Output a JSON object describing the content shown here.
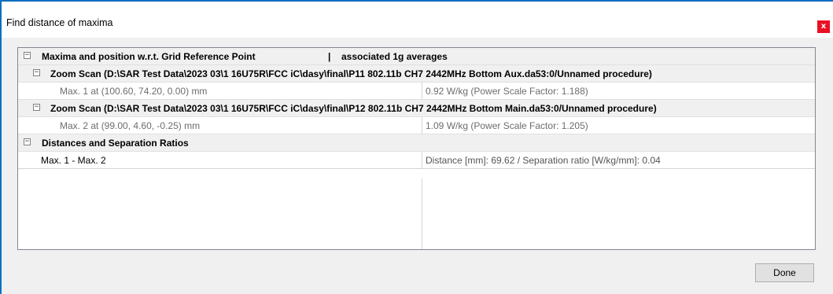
{
  "window": {
    "title": "Find distance of maxima",
    "close_glyph": "x"
  },
  "tree": {
    "header": {
      "col1": "Maxima and position w.r.t. Grid Reference Point",
      "separator": "|",
      "col2": "associated 1g averages"
    },
    "scans": [
      {
        "label": "Zoom Scan (D:\\SAR Test Data\\2023 03\\1 16U75R\\FCC iC\\dasy\\final\\P11 802.11b CH7 2442MHz Bottom Aux.da53:0/Unnamed procedure)",
        "max_position": "Max. 1 at (100.60, 74.20, 0.00) mm",
        "max_value": "0.92 W/kg (Power Scale Factor: 1.188)"
      },
      {
        "label": "Zoom Scan (D:\\SAR Test Data\\2023 03\\1 16U75R\\FCC iC\\dasy\\final\\P12 802.11b CH7 2442MHz Bottom Main.da53:0/Unnamed procedure)",
        "max_position": "Max. 2 at (99.00, 4.60, -0.25) mm",
        "max_value": "1.09 W/kg (Power Scale Factor: 1.205)"
      }
    ],
    "distances": {
      "label": "Distances and Separation Ratios",
      "pair": "Max. 1 - Max. 2",
      "result": "Distance [mm]: 69.62 / Separation ratio [W/kg/mm]: 0.04"
    }
  },
  "buttons": {
    "done": "Done"
  },
  "colors": {
    "accent": "#0a6fc0",
    "close": "#e81123"
  }
}
